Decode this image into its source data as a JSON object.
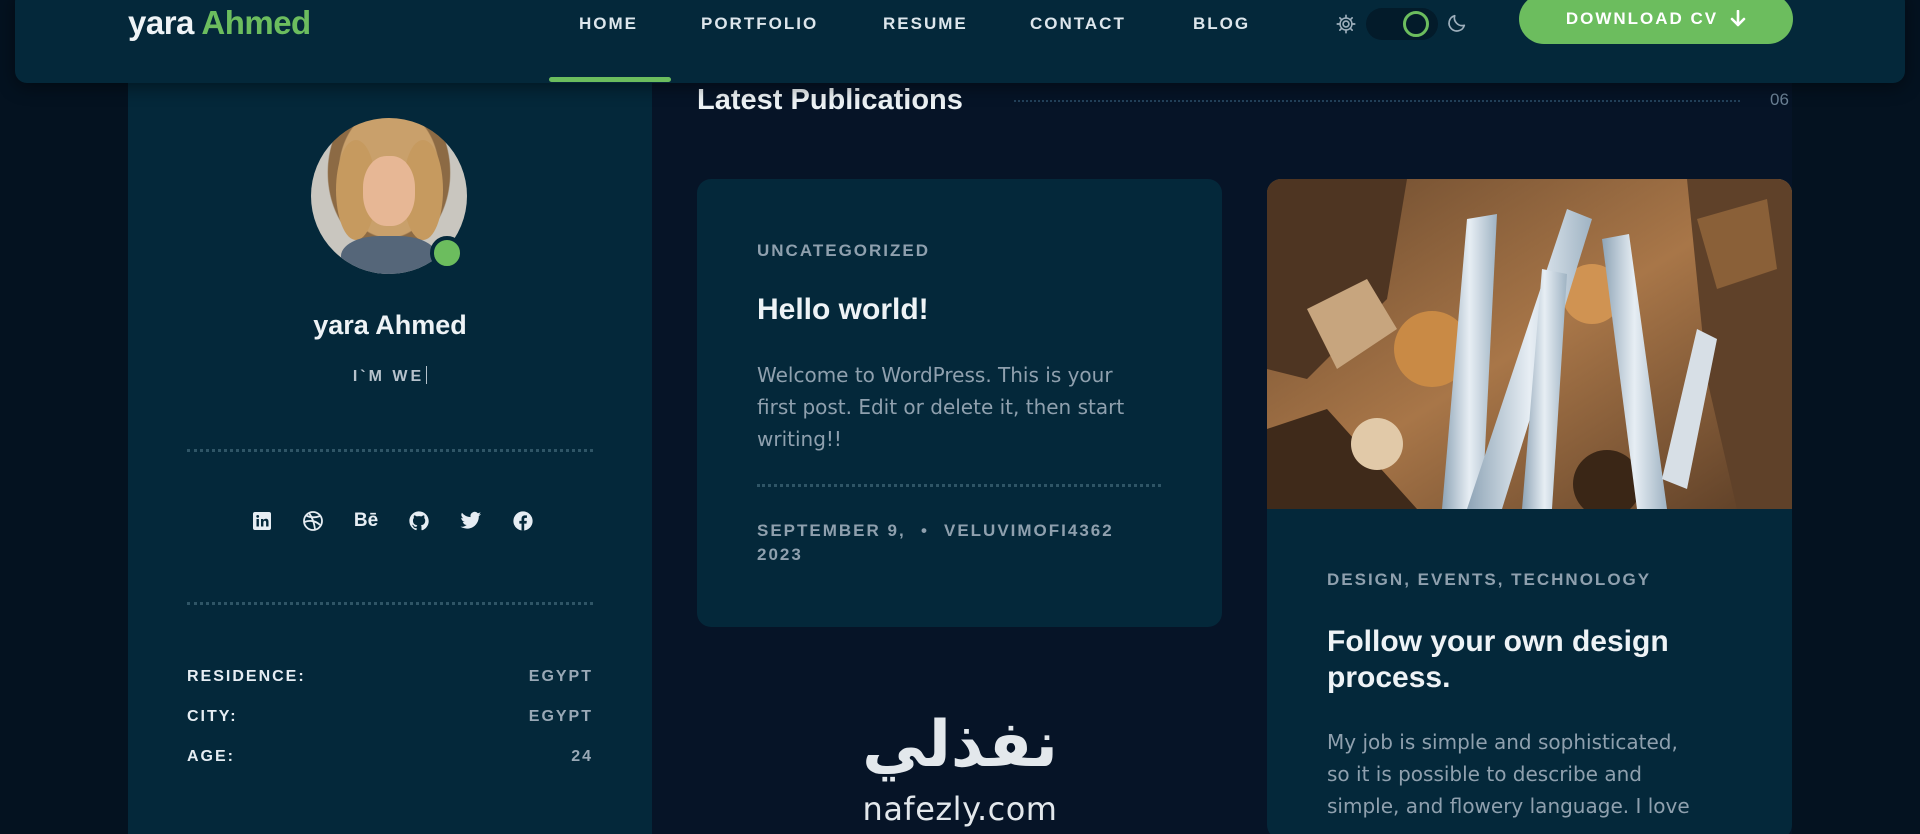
{
  "header": {
    "logo_first": "yara",
    "logo_last": "Ahmed",
    "nav": [
      "HOME",
      "PORTFOLIO",
      "RESUME",
      "CONTACT",
      "BLOG"
    ],
    "active_nav": "HOME",
    "download_label": "DOWNLOAD CV"
  },
  "profile": {
    "name": "yara Ahmed",
    "role": "I`M WE",
    "socials": [
      "linkedin-icon",
      "dribbble-icon",
      "behance-icon",
      "github-icon",
      "twitter-icon",
      "facebook-icon"
    ],
    "behance_text": "Bē",
    "info": [
      {
        "label": "RESIDENCE:",
        "value": "EGYPT"
      },
      {
        "label": "CITY:",
        "value": "EGYPT"
      },
      {
        "label": "AGE:",
        "value": "24"
      }
    ]
  },
  "publications": {
    "title": "Latest Publications",
    "count": "06",
    "posts": [
      {
        "category": "UNCATEGORIZED",
        "title": "Hello world!",
        "excerpt_lines": [
          "Welcome to WordPress. This is your",
          "first post. Edit or delete it, then start",
          "writing!!"
        ],
        "date_lines": [
          "SEPTEMBER 9,",
          "2023"
        ],
        "separator": "•",
        "author": "VELUVIMOFI4362"
      },
      {
        "categories": [
          "DESIGN",
          "EVENTS",
          "TECHNOLOGY"
        ],
        "category_separator": ",",
        "title_lines": [
          "Follow your own design",
          "process."
        ],
        "excerpt_lines": [
          "My job is simple and sophisticated,",
          "so it is possible to describe and",
          "simple, and flowery language. I love"
        ]
      }
    ]
  },
  "watermark": {
    "arabic": "نفذلي",
    "english": "nafezly.com"
  },
  "colors": {
    "accent": "#6cbd5e",
    "panel": "#04283a",
    "background": "#061427"
  }
}
